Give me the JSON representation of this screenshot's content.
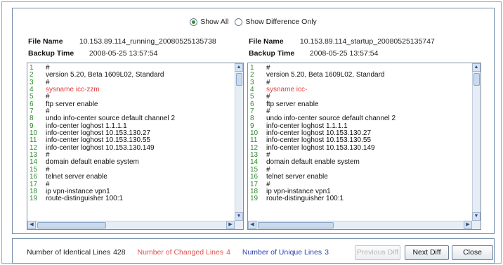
{
  "view_options": {
    "show_all_label": "Show All",
    "show_all_selected": true,
    "show_difference_only_label": "Show Difference Only",
    "show_difference_only_selected": false
  },
  "left_pane": {
    "file_name_label": "File Name",
    "file_name": "10.153.89.114_running_20080525135738",
    "backup_time_label": "Backup Time",
    "backup_time": "2008-05-25 13:57:54",
    "lines": [
      {
        "n": "1",
        "text": "#",
        "changed": false
      },
      {
        "n": "2",
        "text": "version 5.20, Beta 1609L02, Standard",
        "changed": false
      },
      {
        "n": "3",
        "text": "#",
        "changed": false
      },
      {
        "n": "4",
        "text": "sysname icc-zzm",
        "changed": true
      },
      {
        "n": "5",
        "text": "#",
        "changed": false
      },
      {
        "n": "6",
        "text": "ftp server enable",
        "changed": false
      },
      {
        "n": "7",
        "text": "#",
        "changed": false
      },
      {
        "n": "8",
        "text": "undo info-center source default channel 2",
        "changed": false
      },
      {
        "n": "9",
        "text": "info-center loghost 1.1.1.1",
        "changed": false
      },
      {
        "n": "10",
        "text": "info-center loghost 10.153.130.27",
        "changed": false
      },
      {
        "n": "11",
        "text": "info-center loghost 10.153.130.55",
        "changed": false
      },
      {
        "n": "12",
        "text": "info-center loghost 10.153.130.149",
        "changed": false
      },
      {
        "n": "13",
        "text": "#",
        "changed": false
      },
      {
        "n": "14",
        "text": "domain default enable system",
        "changed": false
      },
      {
        "n": "15",
        "text": "#",
        "changed": false
      },
      {
        "n": "16",
        "text": "telnet server enable",
        "changed": false
      },
      {
        "n": "17",
        "text": "#",
        "changed": false
      },
      {
        "n": "18",
        "text": "ip vpn-instance vpn1",
        "changed": false
      },
      {
        "n": "19",
        "text": "route-distinguisher 100:1",
        "changed": false
      }
    ]
  },
  "right_pane": {
    "file_name_label": "File Name",
    "file_name": "10.153.89.114_startup_20080525135747",
    "backup_time_label": "Backup Time",
    "backup_time": "2008-05-25 13:57:54",
    "lines": [
      {
        "n": "1",
        "text": "#",
        "changed": false
      },
      {
        "n": "2",
        "text": "version 5.20, Beta 1609L02, Standard",
        "changed": false
      },
      {
        "n": "3",
        "text": "#",
        "changed": false
      },
      {
        "n": "4",
        "text": "sysname icc-",
        "changed": true
      },
      {
        "n": "5",
        "text": "#",
        "changed": false
      },
      {
        "n": "6",
        "text": "ftp server enable",
        "changed": false
      },
      {
        "n": "7",
        "text": "#",
        "changed": false
      },
      {
        "n": "8",
        "text": "undo info-center source default channel 2",
        "changed": false
      },
      {
        "n": "9",
        "text": "info-center loghost 1.1.1.1",
        "changed": false
      },
      {
        "n": "10",
        "text": "info-center loghost 10.153.130.27",
        "changed": false
      },
      {
        "n": "11",
        "text": "info-center loghost 10.153.130.55",
        "changed": false
      },
      {
        "n": "12",
        "text": "info-center loghost 10.153.130.149",
        "changed": false
      },
      {
        "n": "13",
        "text": "#",
        "changed": false
      },
      {
        "n": "14",
        "text": "domain default enable system",
        "changed": false
      },
      {
        "n": "15",
        "text": "#",
        "changed": false
      },
      {
        "n": "16",
        "text": "telnet server enable",
        "changed": false
      },
      {
        "n": "17",
        "text": "#",
        "changed": false
      },
      {
        "n": "18",
        "text": "ip vpn-instance vpn1",
        "changed": false
      },
      {
        "n": "19",
        "text": "route-distinguisher 100:1",
        "changed": false
      }
    ]
  },
  "scroll_glyphs": {
    "up": "▲",
    "down": "▼",
    "left": "◀",
    "right": "▶"
  },
  "stats": {
    "identical_label": "Number of Identical Lines",
    "identical_count": "428",
    "changed_label": "Number of Changed Lines",
    "changed_count": "4",
    "unique_label": "Number of Unique Lines",
    "unique_count": "3"
  },
  "buttons": {
    "previous_diff": "Previous Diff",
    "next_diff": "Next Diff",
    "close": "Close"
  },
  "colors": {
    "line_number": "#2d8a2d",
    "changed_text": "#e04040",
    "unique_text": "#2d3fa8",
    "border": "#6f8ba8"
  }
}
